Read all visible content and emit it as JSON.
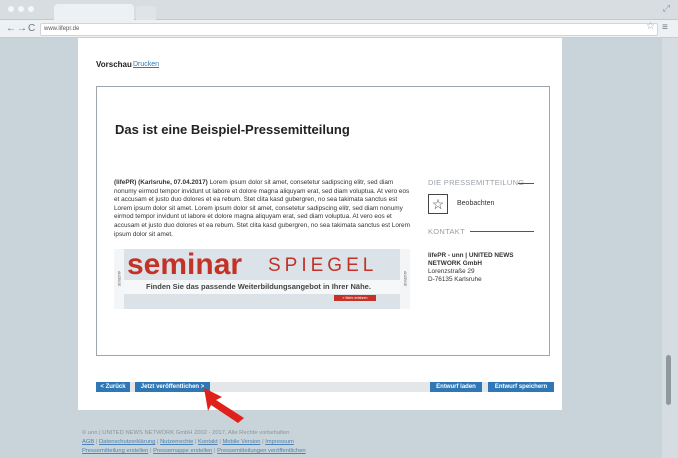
{
  "browser": {
    "url": "www.lifepr.de"
  },
  "preview": {
    "heading": "Vorschau",
    "print_link": "Drucken"
  },
  "press_release": {
    "title": "Das ist eine Beispiel-Pressemitteilung",
    "lead": "(lifePR) (Karlsruhe, 07.04.2017)",
    "body": "Lorem ipsum dolor sit amet, consetetur sadipscing elitr, sed diam nonumy eirmod tempor invidunt ut labore et dolore magna aliquyam erat, sed diam voluptua. At vero eos et accusam et justo duo dolores et ea rebum. Stet clita kasd gubergren, no sea takimata sanctus est Lorem ipsum dolor sit amet. Lorem ipsum dolor sit amet, consetetur sadipscing elitr, sed diam nonumy eirmod tempor invidunt ut labore et dolore magna aliquyam erat, sed diam voluptua. At vero eos et accusam et justo duo dolores et ea rebum. Stet clita kasd gubergren, no sea takimata sanctus est Lorem ipsum dolor sit amet."
  },
  "banner": {
    "brand_main": "seminar",
    "brand_accent": "SPIEGEL",
    "tagline": "Finden Sie das passende Weiterbildungsangebot in Ihrer Nähe.",
    "side_left": "ANZEIGE",
    "side_right": "ANZEIGE",
    "button": "» Mehr erfahren"
  },
  "sidebar": {
    "pm_heading": "DIE PRESSEMITTEILUNG",
    "watch_label": "Beobachten",
    "kontakt_heading": "KONTAKT",
    "contact_name": "lifePR - unn | UNITED NEWS NETWORK GmbH",
    "contact_street": "Lorenzstraße 29",
    "contact_city": "D-76135 Karlsruhe"
  },
  "buttons": {
    "back": "< Zurück",
    "publish": "Jetzt veröffentlichen >",
    "load_draft": "Entwurf laden",
    "save_draft": "Entwurf speichern"
  },
  "footer": {
    "copyright": "© unn | UNITED NEWS NETWORK GmbH 2002 - 2017, Alle Rechte vorbehalten",
    "links_row1": [
      "AGB",
      "Datenschutzerklärung",
      "Nutzerrechte",
      "Kontakt",
      "Mobile Version",
      "Impressum"
    ],
    "links_row2": [
      "Pressemitteilung erstellen",
      "Pressemappe erstellen",
      "Pressemitteilungen veröffentlichen"
    ]
  },
  "colors": {
    "button_blue": "#2f78b5",
    "brand_red": "#c43126",
    "arrow_red": "#e0201a"
  }
}
